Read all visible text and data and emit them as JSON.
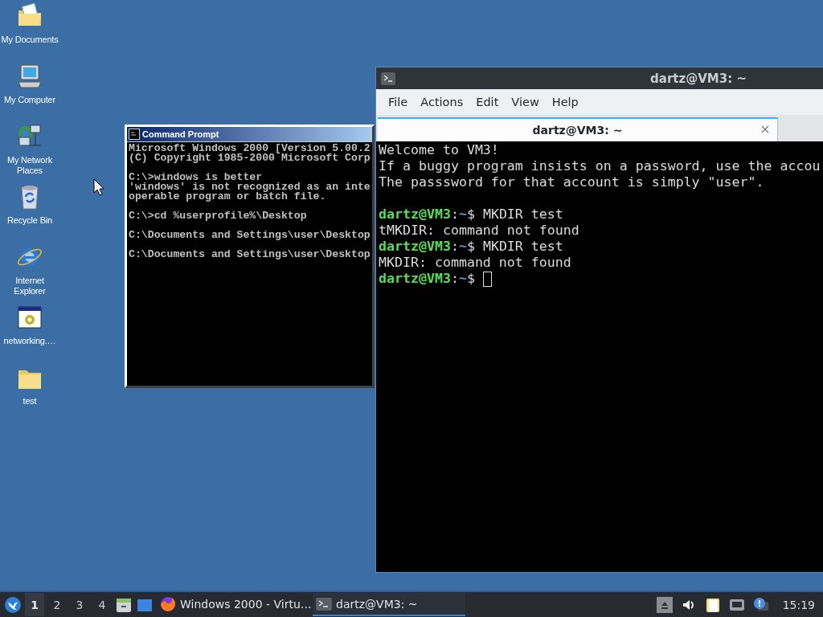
{
  "desktop": {
    "icons": [
      {
        "label": "My Documents",
        "kind": "documents"
      },
      {
        "label": "My Computer",
        "kind": "computer"
      },
      {
        "label": "My Network Places",
        "kind": "network"
      },
      {
        "label": "Recycle Bin",
        "kind": "recycle"
      },
      {
        "label": "Internet Explorer",
        "kind": "browser"
      },
      {
        "label": "networking.…",
        "kind": "program"
      },
      {
        "label": "test",
        "kind": "folder"
      }
    ]
  },
  "cmd_window": {
    "title": "Command Prompt",
    "blocks": [
      [
        "Microsoft Windows 2000 [Version 5.00.2",
        "(C) Copyright 1985-2000 Microsoft Corp"
      ],
      [
        "C:\\>windows is better",
        "'windows' is not recognized as an inte",
        "operable program or batch file."
      ],
      [
        "C:\\>cd %userprofile%\\Desktop"
      ],
      [
        "C:\\Documents and Settings\\user\\Desktop"
      ],
      [
        "C:\\Documents and Settings\\user\\Desktop"
      ]
    ]
  },
  "terminal_window": {
    "title": "dartz@VM3: ~",
    "menu": [
      "File",
      "Actions",
      "Edit",
      "View",
      "Help"
    ],
    "tabs": [
      {
        "label": "dartz@VM3: ~",
        "selected": true
      }
    ],
    "blocks": [
      [
        {
          "kind": "output",
          "text": "Welcome to VM3!"
        },
        {
          "kind": "output",
          "text": "If a buggy program insists on a password, use the accou"
        },
        {
          "kind": "output",
          "text": "The passsword for that account is simply \"user\"."
        }
      ],
      [
        {
          "kind": "prompt",
          "host": "dartz@VM3",
          "separator": ":",
          "path": "~",
          "symbol": "$",
          "command": "MKDIR test",
          "cursor": false
        },
        {
          "kind": "output",
          "text": "tMKDIR: command not found"
        },
        {
          "kind": "prompt",
          "host": "dartz@VM3",
          "separator": ":",
          "path": "~",
          "symbol": "$",
          "command": "MKDIR test",
          "cursor": false
        },
        {
          "kind": "output",
          "text": "MKDIR: command not found"
        },
        {
          "kind": "prompt",
          "host": "dartz@VM3",
          "separator": ":",
          "path": "~",
          "symbol": "$",
          "cursor": true
        }
      ]
    ]
  },
  "taskbar": {
    "workspaces": [
      {
        "label": "1",
        "selected": true
      },
      {
        "label": "2",
        "selected": false
      },
      {
        "label": "3",
        "selected": false
      },
      {
        "label": "4",
        "selected": false
      }
    ],
    "tasks": [
      {
        "label": "Windows 2000 - Virtu…",
        "kind": "browser",
        "selected": false
      },
      {
        "label": "dartz@VM3: ~",
        "kind": "terminal",
        "selected": true
      }
    ],
    "clock": "15:19"
  }
}
